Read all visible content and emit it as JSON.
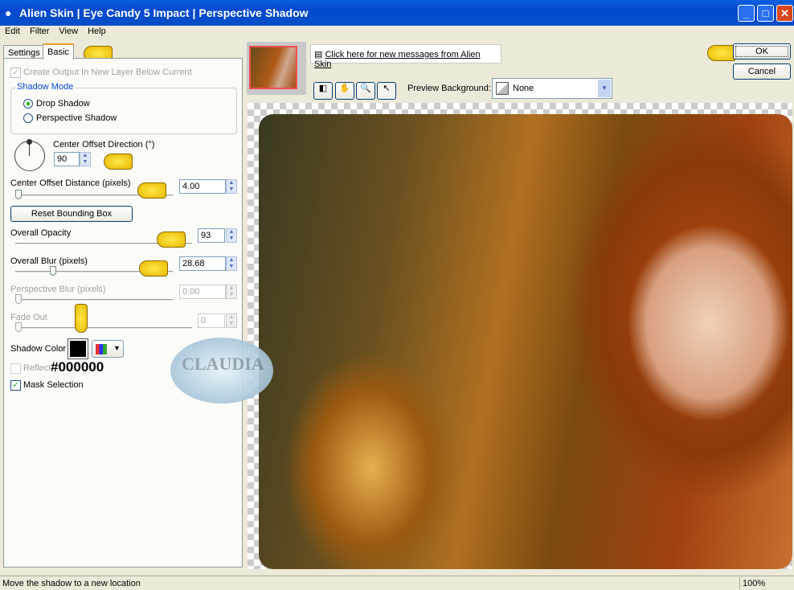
{
  "window": {
    "title": "Alien Skin | Eye Candy 5 Impact | Perspective Shadow",
    "minimize": "_",
    "maximize": "□",
    "close": "✕"
  },
  "menu": [
    "Edit",
    "Filter",
    "View",
    "Help"
  ],
  "tabs": [
    {
      "label": "Settings",
      "active": false
    },
    {
      "label": "Basic",
      "active": true
    }
  ],
  "basic": {
    "create_output": {
      "label": "Create Output In New Layer Below Current",
      "checked": true,
      "enabled": false
    },
    "shadow_mode": {
      "legend": "Shadow Mode",
      "options": [
        {
          "label": "Drop Shadow",
          "selected": true
        },
        {
          "label": "Perspective Shadow",
          "selected": false
        }
      ]
    },
    "direction": {
      "label": "Center Offset Direction (°)",
      "value": "90"
    },
    "distance": {
      "label": "Center Offset Distance (pixels)",
      "value": "4.00",
      "slider_fraction": 0.02
    },
    "reset_button": "Reset Bounding Box",
    "opacity": {
      "label": "Overall Opacity",
      "value": "93",
      "slider_fraction": 0.93
    },
    "blur": {
      "label": "Overall Blur (pixels)",
      "value": "28.68",
      "slider_fraction": 0.29
    },
    "perspective_blur": {
      "label": "Perspective Blur (pixels)",
      "value": "0.00",
      "enabled": false
    },
    "fade_out": {
      "label": "Fade Out",
      "value": "0",
      "enabled": false
    },
    "shadow_color": {
      "label": "Shadow Color",
      "color": "#000000",
      "annotation": "#000000"
    },
    "reflect": {
      "label": "Reflect",
      "checked": false,
      "enabled": false
    },
    "mask_selection": {
      "label": "Mask Selection",
      "checked": true
    }
  },
  "messages_link": "Click here for new messages from Alien Skin",
  "toolbar": {
    "tools": [
      "preview-icon",
      "hand-icon",
      "zoom-icon",
      "pointer-icon"
    ],
    "preview_bg_label": "Preview Background:",
    "preview_bg_value": "None"
  },
  "ok_label": "OK",
  "cancel_label": "Cancel",
  "watermark": "CLAUDIA",
  "status": {
    "text": "Move the shadow to a new location",
    "zoom": "100%"
  }
}
